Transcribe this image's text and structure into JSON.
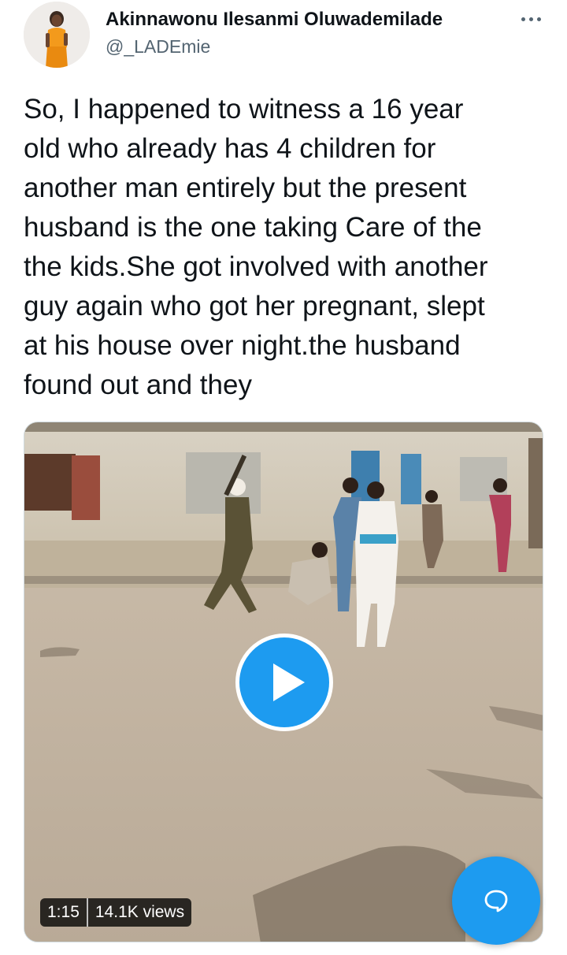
{
  "author": {
    "display_name": "Akinnawonu Ilesanmi Oluwademilade",
    "handle": "@_LADEmie",
    "avatar_icon": "profile-photo"
  },
  "header": {
    "more_icon": "more-horizontal-icon"
  },
  "tweet": {
    "text": "So, I happened to witness a 16 year\nold who already has 4 children for\nanother man entirely but the present\nhusband is the one taking Care of the\nthe kids.She got involved with another\nguy again who got her pregnant, slept\nat his house over night.the husband\nfound out and they"
  },
  "media": {
    "type": "video",
    "play_icon": "play-icon",
    "duration": "1:15",
    "views": "14.1K views"
  },
  "fab": {
    "icon": "reply-bubble-icon"
  },
  "colors": {
    "accent": "#1d9bf0",
    "text": "#0f1419",
    "secondary": "#536471"
  }
}
